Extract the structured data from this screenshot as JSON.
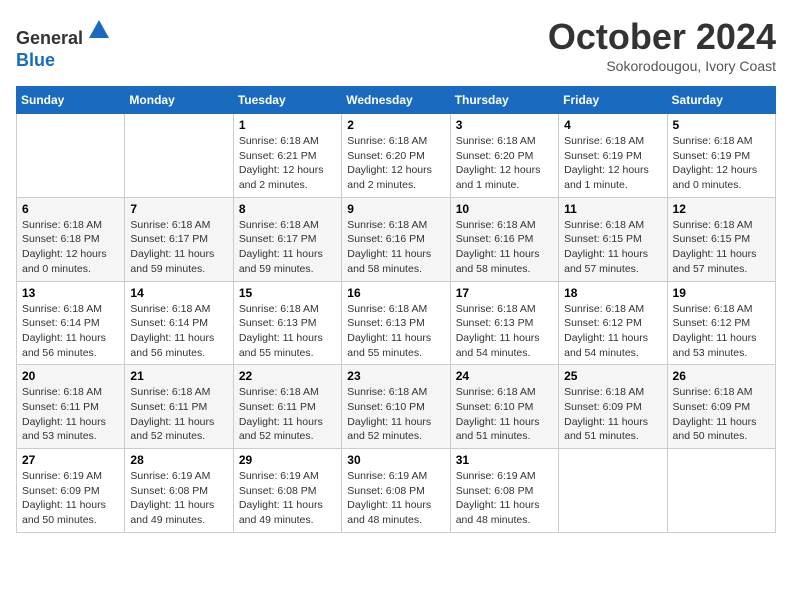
{
  "header": {
    "logo_line1": "General",
    "logo_line2": "Blue",
    "month_title": "October 2024",
    "subtitle": "Sokorodougou, Ivory Coast"
  },
  "columns": [
    "Sunday",
    "Monday",
    "Tuesday",
    "Wednesday",
    "Thursday",
    "Friday",
    "Saturday"
  ],
  "weeks": [
    [
      {
        "day": "",
        "text": ""
      },
      {
        "day": "",
        "text": ""
      },
      {
        "day": "1",
        "text": "Sunrise: 6:18 AM\nSunset: 6:21 PM\nDaylight: 12 hours and 2 minutes."
      },
      {
        "day": "2",
        "text": "Sunrise: 6:18 AM\nSunset: 6:20 PM\nDaylight: 12 hours and 2 minutes."
      },
      {
        "day": "3",
        "text": "Sunrise: 6:18 AM\nSunset: 6:20 PM\nDaylight: 12 hours and 1 minute."
      },
      {
        "day": "4",
        "text": "Sunrise: 6:18 AM\nSunset: 6:19 PM\nDaylight: 12 hours and 1 minute."
      },
      {
        "day": "5",
        "text": "Sunrise: 6:18 AM\nSunset: 6:19 PM\nDaylight: 12 hours and 0 minutes."
      }
    ],
    [
      {
        "day": "6",
        "text": "Sunrise: 6:18 AM\nSunset: 6:18 PM\nDaylight: 12 hours and 0 minutes."
      },
      {
        "day": "7",
        "text": "Sunrise: 6:18 AM\nSunset: 6:17 PM\nDaylight: 11 hours and 59 minutes."
      },
      {
        "day": "8",
        "text": "Sunrise: 6:18 AM\nSunset: 6:17 PM\nDaylight: 11 hours and 59 minutes."
      },
      {
        "day": "9",
        "text": "Sunrise: 6:18 AM\nSunset: 6:16 PM\nDaylight: 11 hours and 58 minutes."
      },
      {
        "day": "10",
        "text": "Sunrise: 6:18 AM\nSunset: 6:16 PM\nDaylight: 11 hours and 58 minutes."
      },
      {
        "day": "11",
        "text": "Sunrise: 6:18 AM\nSunset: 6:15 PM\nDaylight: 11 hours and 57 minutes."
      },
      {
        "day": "12",
        "text": "Sunrise: 6:18 AM\nSunset: 6:15 PM\nDaylight: 11 hours and 57 minutes."
      }
    ],
    [
      {
        "day": "13",
        "text": "Sunrise: 6:18 AM\nSunset: 6:14 PM\nDaylight: 11 hours and 56 minutes."
      },
      {
        "day": "14",
        "text": "Sunrise: 6:18 AM\nSunset: 6:14 PM\nDaylight: 11 hours and 56 minutes."
      },
      {
        "day": "15",
        "text": "Sunrise: 6:18 AM\nSunset: 6:13 PM\nDaylight: 11 hours and 55 minutes."
      },
      {
        "day": "16",
        "text": "Sunrise: 6:18 AM\nSunset: 6:13 PM\nDaylight: 11 hours and 55 minutes."
      },
      {
        "day": "17",
        "text": "Sunrise: 6:18 AM\nSunset: 6:13 PM\nDaylight: 11 hours and 54 minutes."
      },
      {
        "day": "18",
        "text": "Sunrise: 6:18 AM\nSunset: 6:12 PM\nDaylight: 11 hours and 54 minutes."
      },
      {
        "day": "19",
        "text": "Sunrise: 6:18 AM\nSunset: 6:12 PM\nDaylight: 11 hours and 53 minutes."
      }
    ],
    [
      {
        "day": "20",
        "text": "Sunrise: 6:18 AM\nSunset: 6:11 PM\nDaylight: 11 hours and 53 minutes."
      },
      {
        "day": "21",
        "text": "Sunrise: 6:18 AM\nSunset: 6:11 PM\nDaylight: 11 hours and 52 minutes."
      },
      {
        "day": "22",
        "text": "Sunrise: 6:18 AM\nSunset: 6:11 PM\nDaylight: 11 hours and 52 minutes."
      },
      {
        "day": "23",
        "text": "Sunrise: 6:18 AM\nSunset: 6:10 PM\nDaylight: 11 hours and 52 minutes."
      },
      {
        "day": "24",
        "text": "Sunrise: 6:18 AM\nSunset: 6:10 PM\nDaylight: 11 hours and 51 minutes."
      },
      {
        "day": "25",
        "text": "Sunrise: 6:18 AM\nSunset: 6:09 PM\nDaylight: 11 hours and 51 minutes."
      },
      {
        "day": "26",
        "text": "Sunrise: 6:18 AM\nSunset: 6:09 PM\nDaylight: 11 hours and 50 minutes."
      }
    ],
    [
      {
        "day": "27",
        "text": "Sunrise: 6:19 AM\nSunset: 6:09 PM\nDaylight: 11 hours and 50 minutes."
      },
      {
        "day": "28",
        "text": "Sunrise: 6:19 AM\nSunset: 6:08 PM\nDaylight: 11 hours and 49 minutes."
      },
      {
        "day": "29",
        "text": "Sunrise: 6:19 AM\nSunset: 6:08 PM\nDaylight: 11 hours and 49 minutes."
      },
      {
        "day": "30",
        "text": "Sunrise: 6:19 AM\nSunset: 6:08 PM\nDaylight: 11 hours and 48 minutes."
      },
      {
        "day": "31",
        "text": "Sunrise: 6:19 AM\nSunset: 6:08 PM\nDaylight: 11 hours and 48 minutes."
      },
      {
        "day": "",
        "text": ""
      },
      {
        "day": "",
        "text": ""
      }
    ]
  ]
}
